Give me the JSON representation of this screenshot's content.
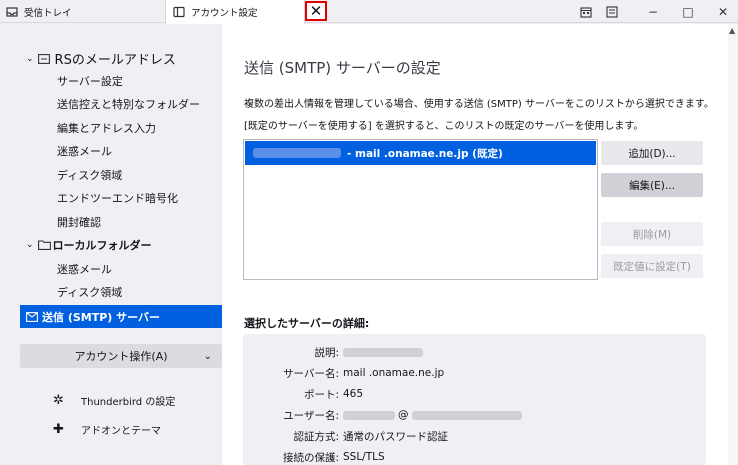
{
  "tabs": [
    {
      "label": "受信トレイ",
      "icon": "inbox-icon"
    },
    {
      "label": "アカウント設定",
      "icon": "account-settings-icon"
    }
  ],
  "tab_close_symbol": "✕",
  "window_controls": {
    "minimize": "−",
    "maximize": "□",
    "close": "✕"
  },
  "sidebar": {
    "account_name": "RSのメールアドレス",
    "account_items": [
      "サーバー設定",
      "送信控えと特別なフォルダー",
      "編集とアドレス入力",
      "迷惑メール",
      "ディスク領域",
      "エンドツーエンド暗号化",
      "開封確認"
    ],
    "local_folders": "ローカルフォルダー",
    "local_items": [
      "迷惑メール",
      "ディスク領域"
    ],
    "selected": "送信 (SMTP) サーバー",
    "account_ops": "アカウント操作(A)",
    "bottom": [
      {
        "label": "Thunderbird の設定",
        "icon": "gear-icon"
      },
      {
        "label": "アドオンとテーマ",
        "icon": "puzzle-icon"
      }
    ]
  },
  "main": {
    "title": "送信 (SMTP) サーバーの設定",
    "description": "複数の差出人情報を管理している場合、使用する送信 (SMTP) サーバーをこのリストから選択できます。[既定のサーバーを使用する] を選択すると、このリストの既定のサーバーを使用します。",
    "server_entry": "- mail .onamae.ne.jp (既定)",
    "buttons": {
      "add": "追加(D)...",
      "edit": "編集(E)...",
      "remove": "削除(M)",
      "set_default": "既定値に設定(T)"
    },
    "details_title": "選択したサーバーの詳細:",
    "details": [
      {
        "label": "説明:",
        "value": ""
      },
      {
        "label": "サーバー名:",
        "value": "mail .onamae.ne.jp"
      },
      {
        "label": "ポート:",
        "value": "465"
      },
      {
        "label": "ユーザー名:",
        "value": "@"
      },
      {
        "label": "認証方式:",
        "value": "通常のパスワード認証"
      },
      {
        "label": "接続の保護:",
        "value": "SSL/TLS"
      }
    ]
  }
}
